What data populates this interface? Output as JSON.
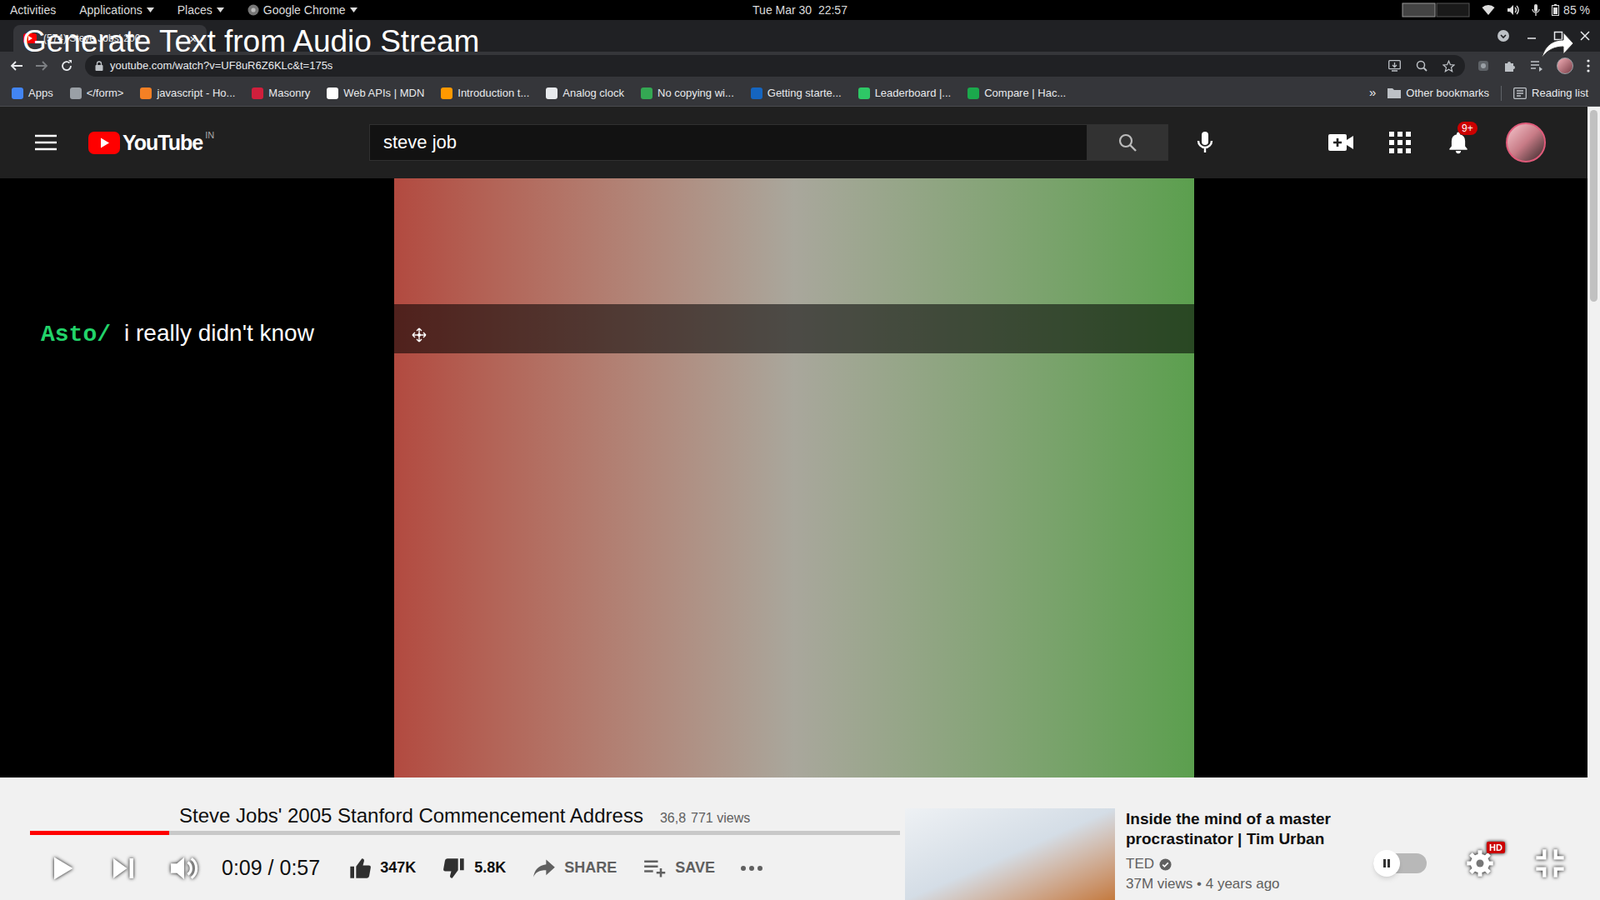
{
  "system_bar": {
    "activities": "Activities",
    "menus": [
      "Applications",
      "Places",
      "Google Chrome"
    ],
    "clock": "Tue Mar 30  22:57",
    "battery": "85 %"
  },
  "overlay": {
    "title": "Generate Text from Audio Stream"
  },
  "browser": {
    "tab": {
      "title": "(574) Steve Jobs' 200",
      "close": "×"
    },
    "address": "youtube.com/watch?v=UF8uR6Z6KLc&t=175s",
    "bookmarks": [
      {
        "label": "Apps",
        "color": "#4285f4"
      },
      {
        "label": "</form>",
        "color": "#9aa0a6"
      },
      {
        "label": "javascript - Ho...",
        "color": "#f48024"
      },
      {
        "label": "Masonry",
        "color": "#d01f3c"
      },
      {
        "label": "Web APIs | MDN",
        "color": "#ffffff"
      },
      {
        "label": "Introduction t...",
        "color": "#ff9900"
      },
      {
        "label": "Analog clock",
        "color": "#e8eaed"
      },
      {
        "label": "No copying wi...",
        "color": "#34a853"
      },
      {
        "label": "Getting starte...",
        "color": "#1565c0"
      },
      {
        "label": "Leaderboard |...",
        "color": "#2ec866"
      },
      {
        "label": "Compare | Hac...",
        "color": "#1ba94c"
      }
    ],
    "bookmarks_more": "»",
    "other_bookmarks": "Other bookmarks",
    "reading_list": "Reading list"
  },
  "youtube": {
    "logo": "YouTube",
    "region": "IN",
    "search": {
      "value": "steve job"
    },
    "notifications": "9+"
  },
  "caption": {
    "speaker": "Asto/",
    "text": "i really didn't know"
  },
  "player": {
    "playing": false,
    "progress": {
      "level": 0.16
    },
    "time": "0:09 / 0:57",
    "autoplay": {
      "on": false
    },
    "hd": "HD"
  },
  "video": {
    "title": "Steve Jobs' 2005 Stanford Commencement Address",
    "views": [
      "36,8",
      "771 views"
    ],
    "likes": "347K",
    "dislikes": "5.8K",
    "share": "SHARE",
    "save": "SAVE"
  },
  "up_next": {
    "title": "Inside the mind of a master procrastinator | Tim Urban",
    "channel": "TED",
    "verified": true,
    "meta": "37M views • 4 years ago"
  }
}
